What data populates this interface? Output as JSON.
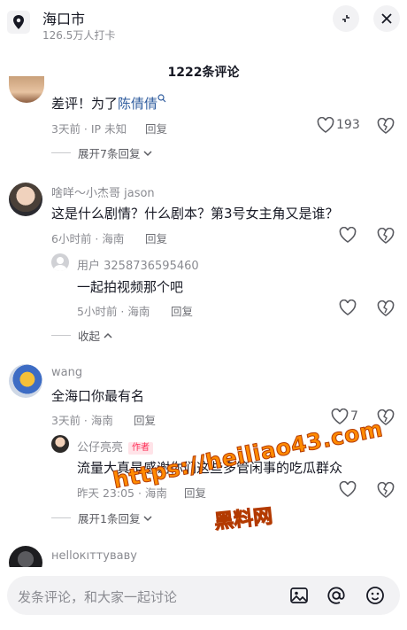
{
  "header": {
    "location_icon": "location-pin-icon",
    "title": "海口市",
    "subtitle": "126.5万人打卡",
    "shrink_icon": "shrink-icon",
    "close_icon": "close-icon"
  },
  "comment_count": "1222条评论",
  "comments": [
    {
      "text": "差评！为了",
      "link": "陈倩倩",
      "meta": "3天前 · IP 未知",
      "reply": "回复",
      "likes": "193",
      "expand": "展开7条回复"
    },
    {
      "name": "啥咩～小杰哥 jason",
      "text": "这是什么剧情？什么剧本？第3号女主角又是谁？",
      "meta": "6小时前 · 海南",
      "reply": "回复",
      "sub": {
        "name": "用户 3258736595460",
        "text": "一起拍视频那个吧",
        "meta": "5小时前 · 海南",
        "reply": "回复"
      },
      "collapse": "收起"
    },
    {
      "name": "wang",
      "text": "全海口你最有名",
      "meta": "3天前 · 海南",
      "reply": "回复",
      "likes": "7",
      "sub": {
        "name": "公仔亮亮",
        "tag": "作者",
        "text": "流量大真是感谢你们这些多管闲事的吃瓜群众",
        "meta": "昨天 23:05 · 海南",
        "reply": "回复"
      },
      "expand": "展开1条回复"
    },
    {
      "name": "нellокıттyвaвy"
    }
  ],
  "watermark": {
    "line1": "https://heiliao43.com",
    "line2": "黑料网"
  },
  "footer": {
    "placeholder": "发条评论，和大家一起讨论",
    "icons": [
      "image-icon",
      "at-icon",
      "emoji-icon"
    ]
  }
}
